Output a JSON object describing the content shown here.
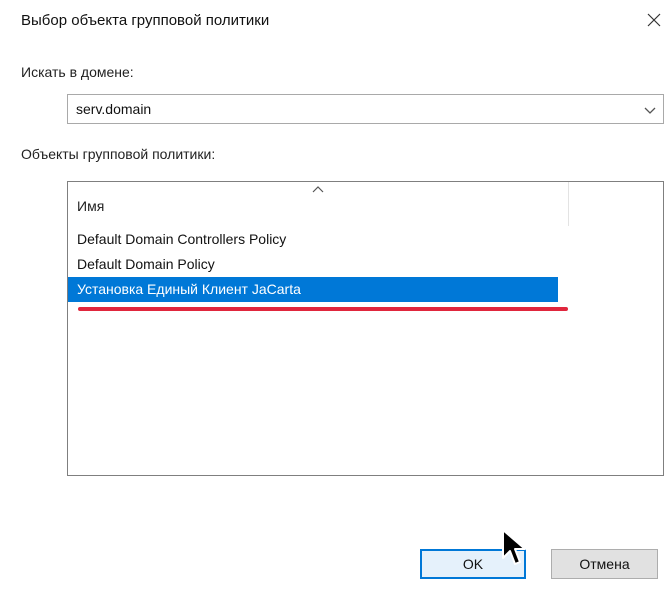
{
  "dialog": {
    "title": "Выбор объекта групповой политики",
    "close_icon": "close-icon"
  },
  "domain": {
    "label": "Искать в домене:",
    "value": "serv.domain",
    "dropdown_icon": "chevron-down-icon"
  },
  "objects": {
    "label": "Объекты групповой политики:",
    "column_header": "Имя",
    "sort_icon": "sort-ascending-icon",
    "items": [
      {
        "name": "Default Domain Controllers Policy",
        "selected": false
      },
      {
        "name": "Default Domain Policy",
        "selected": false
      },
      {
        "name": "Установка Единый Клиент JaCarta",
        "selected": true
      }
    ],
    "highlight_color": "#0078d7",
    "annotation_underline_color": "#e0263d"
  },
  "buttons": {
    "ok": "OK",
    "cancel": "Отмена"
  },
  "cursor_icon": "mouse-pointer-icon"
}
